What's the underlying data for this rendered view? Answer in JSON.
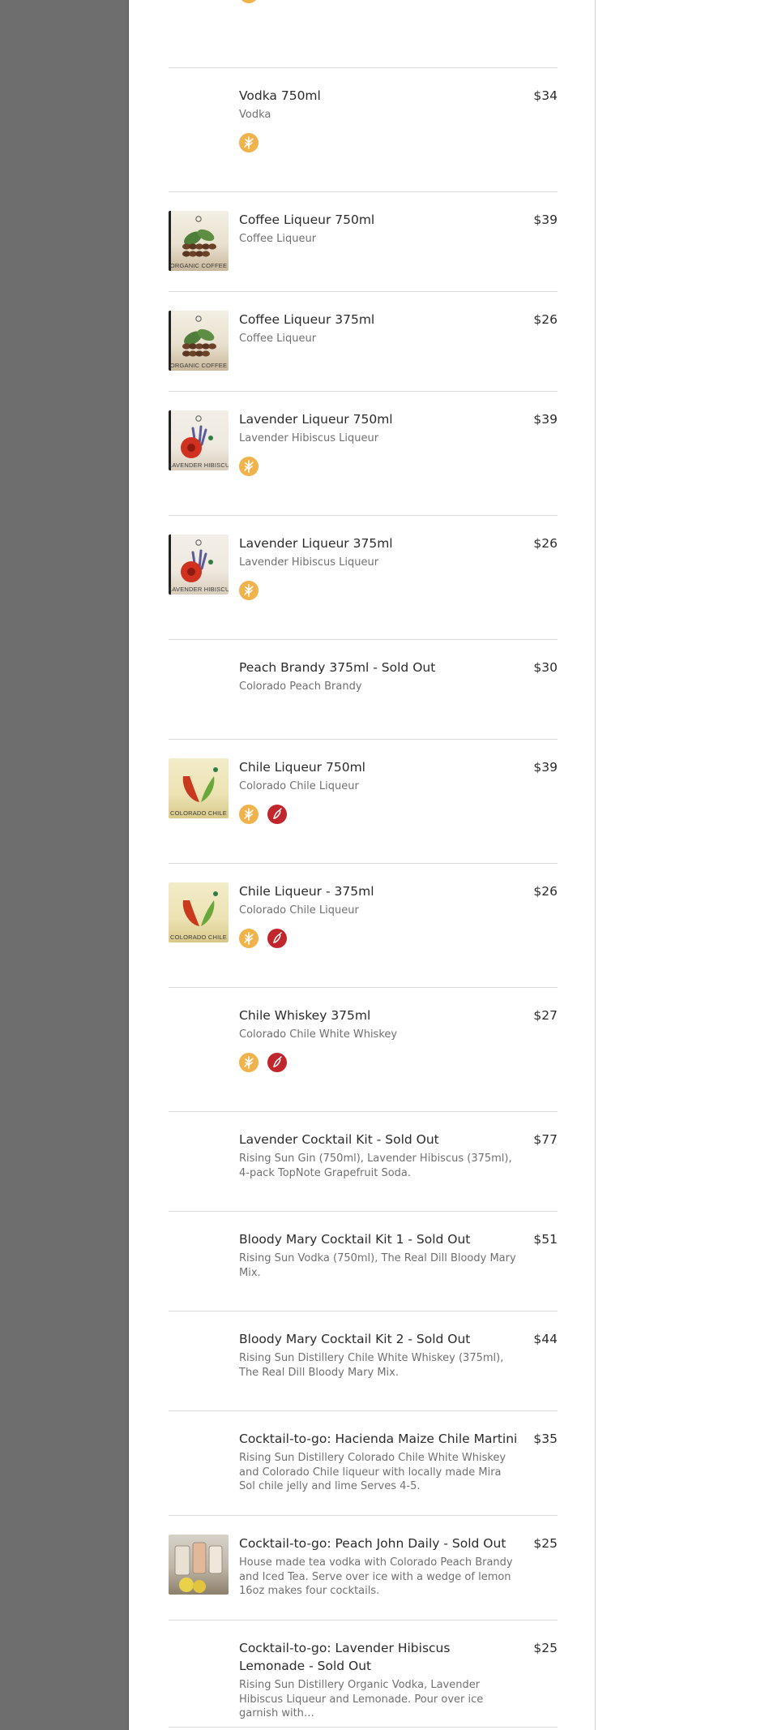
{
  "colors": {
    "left_band": "#6e6e6e",
    "veg_badge": "#f0b24a",
    "spicy_badge": "#c1262c",
    "divider": "#d9d9d9"
  },
  "items": [
    {
      "title": "",
      "price": "",
      "desc": "",
      "icons": [
        "vegan-icon"
      ]
    },
    {
      "title": "Vodka 750ml",
      "price": "$34",
      "desc": "Vodka",
      "icons": [
        "vegan-icon"
      ]
    },
    {
      "title": "Coffee Liqueur 750ml",
      "price": "$39",
      "desc": "Coffee Liqueur",
      "thumb": "coffee",
      "thumb_text": "ORGANIC COFFEE"
    },
    {
      "title": "Coffee Liqueur 375ml",
      "price": "$26",
      "desc": "Coffee Liqueur",
      "thumb": "coffee",
      "thumb_text": "ORGANIC COFFEE"
    },
    {
      "title": "Lavender Liqueur 750ml",
      "price": "$39",
      "desc": "Lavender Hibiscus Liqueur",
      "thumb": "lavender",
      "thumb_text": "LAVENDER HIBISCUS",
      "icons": [
        "vegan-icon"
      ]
    },
    {
      "title": "Lavender Liqueur 375ml",
      "price": "$26",
      "desc": "Lavender Hibiscus Liqueur",
      "thumb": "lavender",
      "thumb_text": "LAVENDER HIBISCUS",
      "icons": [
        "vegan-icon"
      ]
    },
    {
      "title": "Peach Brandy 375ml - Sold Out",
      "price": "$30",
      "desc": "Colorado Peach Brandy"
    },
    {
      "title": "Chile Liqueur 750ml",
      "price": "$39",
      "desc": "Colorado Chile Liqueur",
      "thumb": "chile",
      "thumb_text": "COLORADO CHILE",
      "icons": [
        "vegan-icon",
        "chili-pepper-icon"
      ]
    },
    {
      "title": "Chile Liqueur - 375ml",
      "price": "$26",
      "desc": "Colorado Chile Liqueur",
      "thumb": "chile",
      "thumb_text": "COLORADO CHILE",
      "icons": [
        "vegan-icon",
        "chili-pepper-icon"
      ]
    },
    {
      "title": "Chile Whiskey 375ml",
      "price": "$27",
      "desc": "Colorado Chile White Whiskey",
      "icons": [
        "vegan-icon",
        "chili-pepper-icon"
      ]
    },
    {
      "title": "Lavender Cocktail Kit - Sold Out",
      "price": "$77",
      "desc": "Rising Sun Gin (750ml), Lavender Hibiscus (375ml), 4-pack TopNote Grapefruit Soda."
    },
    {
      "title": "Bloody Mary Cocktail Kit 1 - Sold Out",
      "price": "$51",
      "desc": "Rising Sun Vodka (750ml), The Real Dill Bloody Mary Mix."
    },
    {
      "title": "Bloody Mary Cocktail Kit 2 - Sold Out",
      "price": "$44",
      "desc": "Rising Sun Distillery Chile White Whiskey (375ml), The Real Dill Bloody Mary Mix."
    },
    {
      "title": "Cocktail-to-go: Hacienda Maize Chile Martini",
      "price": "$35",
      "desc": "Rising Sun Distillery Colorado Chile White Whiskey and Colorado Chile liqueur with locally made Mira Sol chile jelly and lime Serves 4-5."
    },
    {
      "title": "Cocktail-to-go: Peach John Daily - Sold Out",
      "price": "$25",
      "desc": "House made tea vodka with Colorado Peach Brandy and Iced Tea. Serve over ice with a wedge of lemon 16oz makes four cocktails.",
      "thumb": "peach"
    },
    {
      "title": "Cocktail-to-go: Lavender Hibiscus Lemonade - Sold Out",
      "price": "$25",
      "desc": "Rising Sun Distillery Organic Vodka, Lavender Hibiscus Liqueur and Lemonade. Pour over ice garnish with…"
    }
  ]
}
